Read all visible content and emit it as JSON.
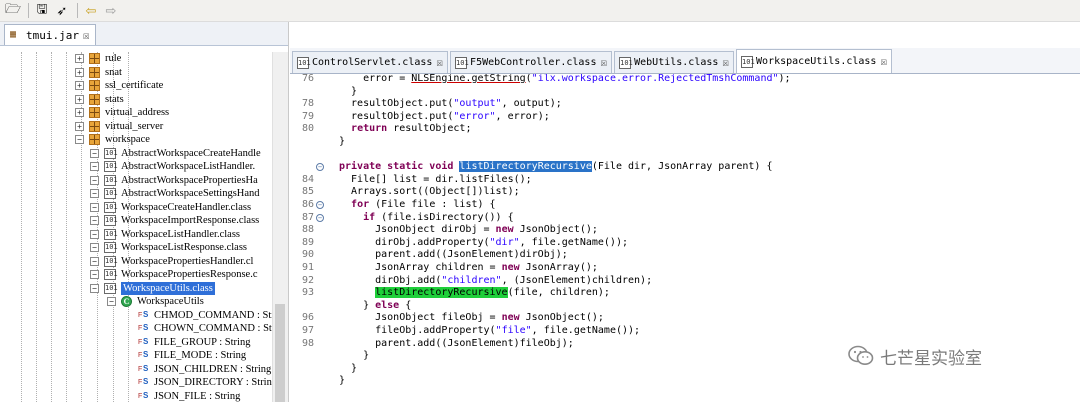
{
  "toolbar": {
    "icons": [
      "open-folder-icon",
      "save-icon",
      "rocket-icon",
      "back-arrow-icon",
      "forward-arrow-icon"
    ]
  },
  "left_panel": {
    "tab_label": "tmui.jar",
    "tree": [
      {
        "label": "rule",
        "kind": "package"
      },
      {
        "label": "snat",
        "kind": "package"
      },
      {
        "label": "ssl_certificate",
        "kind": "package"
      },
      {
        "label": "stats",
        "kind": "package"
      },
      {
        "label": "virtual_address",
        "kind": "package"
      },
      {
        "label": "virtual_server",
        "kind": "package"
      },
      {
        "label": "workspace",
        "kind": "package-open"
      },
      {
        "label": "AbstractWorkspaceCreateHandle",
        "kind": "class"
      },
      {
        "label": "AbstractWorkspaceListHandler.",
        "kind": "class"
      },
      {
        "label": "AbstractWorkspacePropertiesHa",
        "kind": "class"
      },
      {
        "label": "AbstractWorkspaceSettingsHand",
        "kind": "class"
      },
      {
        "label": "WorkspaceCreateHandler.class",
        "kind": "class"
      },
      {
        "label": "WorkspaceImportResponse.class",
        "kind": "class"
      },
      {
        "label": "WorkspaceListHandler.class",
        "kind": "class"
      },
      {
        "label": "WorkspaceListResponse.class",
        "kind": "class"
      },
      {
        "label": "WorkspacePropertiesHandler.cl",
        "kind": "class"
      },
      {
        "label": "WorkspacePropertiesResponse.c",
        "kind": "class"
      },
      {
        "label": "WorkspaceUtils.class",
        "kind": "class-selected"
      },
      {
        "label": "WorkspaceUtils",
        "kind": "type"
      },
      {
        "label": "CHMOD_COMMAND : String",
        "kind": "field"
      },
      {
        "label": "CHOWN_COMMAND : String",
        "kind": "field"
      },
      {
        "label": "FILE_GROUP : String",
        "kind": "field"
      },
      {
        "label": "FILE_MODE : String",
        "kind": "field"
      },
      {
        "label": "JSON_CHILDREN : String",
        "kind": "field"
      },
      {
        "label": "JSON_DIRECTORY : String",
        "kind": "field"
      },
      {
        "label": "JSON_FILE : String",
        "kind": "field"
      }
    ]
  },
  "editor": {
    "tabs": [
      {
        "label": "ControlServlet.class",
        "active": false
      },
      {
        "label": "F5WebController.class",
        "active": false
      },
      {
        "label": "WebUtils.class",
        "active": false
      },
      {
        "label": "WorkspaceUtils.class",
        "active": true
      }
    ],
    "lines": [
      {
        "num": "76",
        "fold": "",
        "html": "    error = <span class=\"ul\">NLSEngine.getString</span>(<span class=\"st\">\"ilx.workspace.error.RejectedTmshCommand\"</span>);"
      },
      {
        "num": "",
        "fold": "",
        "html": "  }"
      },
      {
        "num": "78",
        "fold": "",
        "html": "  resultObject.put(<span class=\"st\">\"output\"</span>, output);"
      },
      {
        "num": "79",
        "fold": "",
        "html": "  resultObject.put(<span class=\"st\">\"error\"</span>, error);"
      },
      {
        "num": "80",
        "fold": "",
        "html": "  <span class=\"kw\">return</span> resultObject;"
      },
      {
        "num": "",
        "fold": "",
        "html": "}"
      },
      {
        "num": "",
        "fold": "",
        "html": ""
      },
      {
        "num": "",
        "fold": "minus",
        "html": "<span class=\"kw\">private static void</span> <span class=\"hl\">listDirectoryRecursive</span>(File dir, JsonArray parent) {"
      },
      {
        "num": "84",
        "fold": "",
        "html": "  File[] list = dir.listFiles();"
      },
      {
        "num": "85",
        "fold": "",
        "html": "  Arrays.sort((Object[])list);"
      },
      {
        "num": "86",
        "fold": "minus",
        "html": "  <span class=\"kw\">for</span> (File file : list) {"
      },
      {
        "num": "87",
        "fold": "minus",
        "html": "    <span class=\"kw\">if</span> (file.isDirectory()) {"
      },
      {
        "num": "88",
        "fold": "",
        "html": "      JsonObject dirObj = <span class=\"kw\">new</span> JsonObject();"
      },
      {
        "num": "89",
        "fold": "",
        "html": "      dirObj.addProperty(<span class=\"st\">\"dir\"</span>, file.getName());"
      },
      {
        "num": "90",
        "fold": "",
        "html": "      parent.add((JsonElement)dirObj);"
      },
      {
        "num": "91",
        "fold": "",
        "html": "      JsonArray children = <span class=\"kw\">new</span> JsonArray();"
      },
      {
        "num": "92",
        "fold": "",
        "html": "      dirObj.add(<span class=\"st\">\"children\"</span>, (JsonElement)children);"
      },
      {
        "num": "93",
        "fold": "",
        "html": "      <span class=\"hg\">listDirectoryRecursive</span>(file, children);"
      },
      {
        "num": "",
        "fold": "",
        "html": "    } <span class=\"kw\">else</span> {"
      },
      {
        "num": "96",
        "fold": "",
        "html": "      JsonObject fileObj = <span class=\"kw\">new</span> JsonObject();"
      },
      {
        "num": "97",
        "fold": "",
        "html": "      fileObj.addProperty(<span class=\"st\">\"file\"</span>, file.getName());"
      },
      {
        "num": "98",
        "fold": "",
        "html": "      parent.add((JsonElement)fileObj);"
      },
      {
        "num": "",
        "fold": "",
        "html": "    }"
      },
      {
        "num": "",
        "fold": "",
        "html": "  }"
      },
      {
        "num": "",
        "fold": "",
        "html": "}"
      }
    ]
  },
  "watermark": {
    "text": "七芒星实验室",
    "icon": "wechat-icon"
  },
  "colors": {
    "keyword": "#7f0055",
    "string": "#2a00ff",
    "selection": "#2a73c8",
    "match_highlight": "#1fcf3a",
    "tree_selection": "#2f6fd8"
  }
}
